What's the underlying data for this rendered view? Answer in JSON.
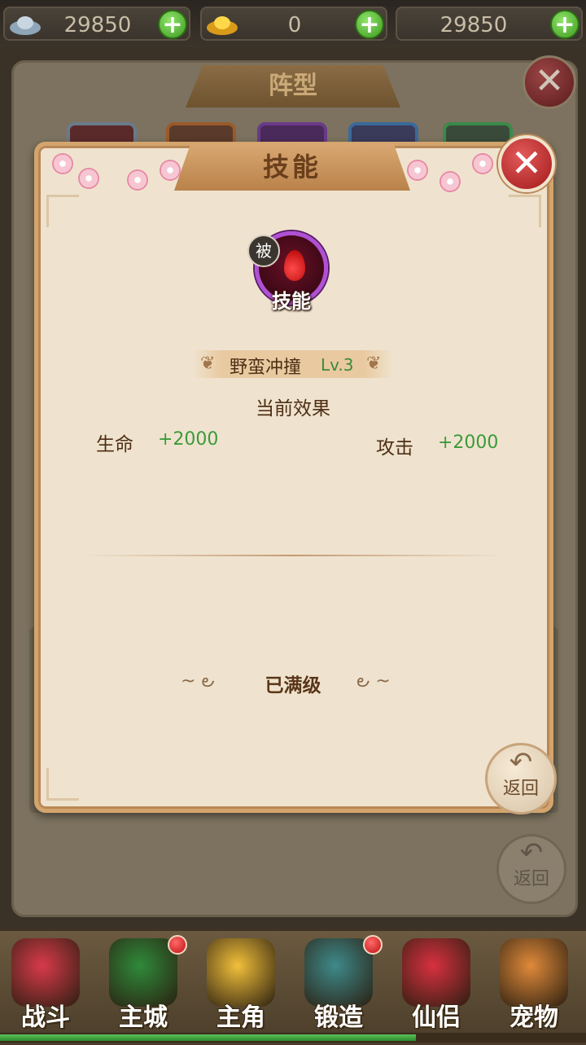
{
  "resources": [
    {
      "icon": "silver-ingot-icon",
      "value": "29850"
    },
    {
      "icon": "gold-ingot-icon",
      "value": "0"
    },
    {
      "icon": "resource-icon",
      "value": "29850"
    }
  ],
  "background_panel": {
    "title": "阵型",
    "return_label": "返回"
  },
  "dialog": {
    "title": "技能",
    "passive_badge": "被",
    "skill_icon_label": "技能",
    "skill_name": "野蛮冲撞",
    "skill_level": "Lv.3",
    "effect_title": "当前效果",
    "stats": [
      {
        "label": "生命",
        "value": "+2000"
      },
      {
        "label": "攻击",
        "value": "+2000"
      }
    ],
    "max_level_text": "已满级",
    "return_label": "返回"
  },
  "nav": [
    {
      "label": "战斗",
      "icon": "battle-icon",
      "color": "#d83a4a",
      "badge": false
    },
    {
      "label": "主城",
      "icon": "city-icon",
      "color": "#2f8a3a",
      "badge": true
    },
    {
      "label": "主角",
      "icon": "hero-icon",
      "color": "#f2c03a",
      "badge": false
    },
    {
      "label": "锻造",
      "icon": "forge-hammer-icon",
      "color": "#3e8a8a",
      "badge": true
    },
    {
      "label": "仙侣",
      "icon": "partner-heart-icon",
      "color": "#d83040",
      "badge": false
    },
    {
      "label": "宠物",
      "icon": "pet-monkey-icon",
      "color": "#e08a3a",
      "badge": false
    }
  ],
  "progress_fraction": 0.71
}
